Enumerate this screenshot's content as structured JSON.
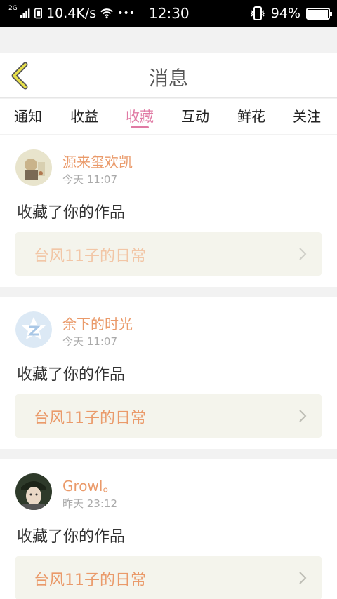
{
  "status_bar": {
    "network": "2G",
    "speed": "10.4K/s",
    "dots": "•••",
    "time": "12:30",
    "battery_percent": "94%",
    "battery_level": 0.94
  },
  "header": {
    "title": "消息"
  },
  "tabs": [
    {
      "label": "通知"
    },
    {
      "label": "收益"
    },
    {
      "label": "收藏"
    },
    {
      "label": "互动"
    },
    {
      "label": "鲜花"
    },
    {
      "label": "关注"
    }
  ],
  "active_tab": "收藏",
  "messages": [
    {
      "user": "源来玺欢凯",
      "time": "今天 11:07",
      "text": "收藏了你的作品",
      "work": "台风11子的日常",
      "avatar_icon": "photo-avatar"
    },
    {
      "user": "余下的时光",
      "time": "今天 11:07",
      "text": "收藏了你的作品",
      "work": "台风11子的日常",
      "avatar_icon": "default-z-avatar"
    },
    {
      "user": "Growl。",
      "time": "昨天 23:12",
      "text": "收藏了你的作品",
      "work": "台风11子的日常",
      "avatar_icon": "photo-avatar"
    }
  ],
  "colors": {
    "accent": "#e07aa4",
    "name": "#ea9a6a",
    "back_arrow": "#e8e04a"
  }
}
